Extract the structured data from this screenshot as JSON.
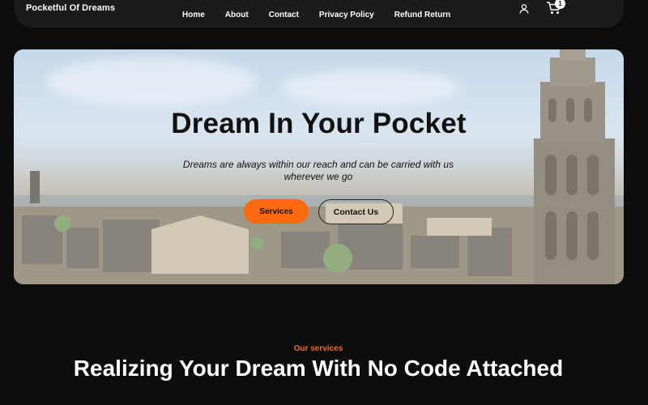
{
  "nav": {
    "brand": "Pocketful Of Dreams",
    "links": [
      "Home",
      "About",
      "Contact",
      "Privacy Policy",
      "Refund Return"
    ],
    "user_icon": "user-icon",
    "cart_icon": "cart-icon",
    "cart_count": "1"
  },
  "hero": {
    "title": "Dream In Your Pocket",
    "subtitle": "Dreams are always within our reach and can be carried with us wherever we go",
    "primary_button": "Services",
    "secondary_button": "Contact Us"
  },
  "services": {
    "eyebrow": "Our services",
    "heading": "Realizing Your Dream With No Code Attached"
  },
  "colors": {
    "background": "#0d0d0e",
    "navbar": "#1b1b1d",
    "accent": "#fb6a11",
    "eyebrow": "#f26a1c"
  }
}
